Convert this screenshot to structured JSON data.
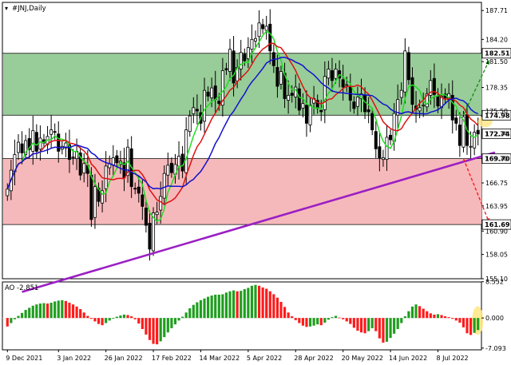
{
  "chart_data": [
    {
      "type": "candlestick",
      "title": "#JNJ,Daily",
      "ylim": [
        155.1,
        188.7
      ],
      "y_ticks": [
        187.71,
        184.2,
        181.5,
        178.35,
        175.5,
        172.74,
        169.7,
        166.75,
        163.95,
        160.9,
        158.05,
        155.1
      ],
      "price_labels": [
        {
          "value": 182.51,
          "color": "#ffffff"
        },
        {
          "value": 174.98,
          "color": "#ffffff"
        },
        {
          "value": 172.74,
          "color": "#ffffff"
        },
        {
          "value": 169.7,
          "color": "#ffffff"
        },
        {
          "value": 161.69,
          "color": "#ffffff"
        }
      ],
      "zones": [
        {
          "name": "resistance",
          "from": 174.98,
          "to": 182.51,
          "color": "#98cc98"
        },
        {
          "name": "support",
          "from": 161.69,
          "to": 169.7,
          "color": "#f6b9bb"
        }
      ],
      "x_labels": [
        "9 Dec 2021",
        "3 Jan 2022",
        "26 Jan 2022",
        "17 Feb 2022",
        "14 Mar 2022",
        "5 Apr 2022",
        "28 Apr 2022",
        "20 May 2022",
        "14 Jun 2022",
        "8 Jul 2022"
      ],
      "closes": [
        166.0,
        168.3,
        170.2,
        171.7,
        170.4,
        171.9,
        170.8,
        173.1,
        170.6,
        172.2,
        171.6,
        172.4,
        173.2,
        172.9,
        170.6,
        171.2,
        171.6,
        169.6,
        169.9,
        170.6,
        167.7,
        169.1,
        167.9,
        162.3,
        166.3,
        164.5,
        165.8,
        168.8,
        169.1,
        169.8,
        169.2,
        169.4,
        167.4,
        171.1,
        166.3,
        166.0,
        165.5,
        163.9,
        161.6,
        158.7,
        163.1,
        163.2,
        165.1,
        167.9,
        168.9,
        168.0,
        169.0,
        170.0,
        168.2,
        173.2,
        174.9,
        175.9,
        175.5,
        174.0,
        178.0,
        177.3,
        178.3,
        176.9,
        176.4,
        180.4,
        180.5,
        183.0,
        178.9,
        180.8,
        182.6,
        181.6,
        183.2,
        184.2,
        184.3,
        186.2,
        185.5,
        185.8,
        182.8,
        181.0,
        178.5,
        180.3,
        177.0,
        177.4,
        177.4,
        178.4,
        175.6,
        176.4,
        174.0,
        176.2,
        177.0,
        175.8,
        175.4,
        179.7,
        180.6,
        179.2,
        180.6,
        179.5,
        178.4,
        178.7,
        176.8,
        175.8,
        177.2,
        177.6,
        175.4,
        175.4,
        173.2,
        170.9,
        169.8,
        169.8,
        172.3,
        172.0,
        175.2,
        176.9,
        178.0,
        182.8,
        179.3,
        176.3,
        175.7,
        175.9,
        176.2,
        177.6,
        179.2,
        177.5,
        176.1,
        177.3,
        177.1,
        177.6,
        174.4,
        174.0,
        171.3,
        174.8,
        171.3,
        171.2,
        172.9,
        172.7
      ],
      "indicators": [
        {
          "name": "fast MA",
          "color": "#22dd22"
        },
        {
          "name": "mid MA",
          "color": "#dd1111"
        },
        {
          "name": "slow MA",
          "color": "#1111cc"
        }
      ],
      "trendline": {
        "color": "#9b1fc4",
        "from": [
          4,
          153.5
        ],
        "to": [
          131,
          170.3
        ]
      },
      "forecast_arrows": [
        {
          "color": "#1e8c1e",
          "from": [
            125,
            175.0
          ],
          "to": [
            131,
            181.7
          ]
        },
        {
          "color": "#ff1a1a",
          "from": [
            125,
            169.7
          ],
          "to": [
            131,
            161.9
          ]
        }
      ]
    },
    {
      "type": "bar",
      "title": "AO -2.851",
      "ylim": [
        -7.5,
        8.5
      ],
      "y_ticks": [
        8.552,
        0.0,
        -7.093
      ],
      "ao_values": [
        -2.0,
        -1.2,
        -0.3,
        0.5,
        1.2,
        1.9,
        2.4,
        2.9,
        3.2,
        3.4,
        3.5,
        3.4,
        3.6,
        3.9,
        4.1,
        4.2,
        4.0,
        3.6,
        3.2,
        2.7,
        2.1,
        1.3,
        0.5,
        -0.2,
        -0.8,
        -1.4,
        -1.7,
        -1.2,
        -0.6,
        -0.1,
        0.3,
        0.6,
        0.8,
        0.7,
        0.4,
        -0.3,
        -1.3,
        -2.6,
        -3.9,
        -5.2,
        -6.1,
        -6.2,
        -5.5,
        -4.5,
        -3.4,
        -2.4,
        -1.5,
        -0.6,
        0.3,
        1.3,
        2.3,
        3.1,
        3.7,
        4.2,
        4.6,
        5.0,
        5.3,
        5.5,
        5.5,
        5.6,
        6.0,
        6.3,
        6.5,
        6.3,
        6.4,
        6.8,
        7.1,
        7.6,
        7.8,
        7.6,
        7.2,
        6.9,
        6.3,
        5.6,
        4.8,
        3.8,
        2.6,
        1.3,
        0.4,
        -0.5,
        -1.2,
        -1.8,
        -2.1,
        -2.0,
        -1.8,
        -1.5,
        -1.7,
        -1.1,
        -0.4,
        0.2,
        0.5,
        0.1,
        -0.3,
        -0.8,
        -1.4,
        -2.3,
        -3.0,
        -3.4,
        -3.6,
        -3.1,
        -2.4,
        -3.1,
        -4.8,
        -5.8,
        -5.6,
        -4.7,
        -3.7,
        -2.6,
        -1.2,
        0.4,
        1.6,
        2.7,
        3.2,
        2.8,
        2.2,
        1.6,
        1.1,
        0.8,
        0.9,
        0.7,
        0.4,
        0.2,
        -0.2,
        -0.6,
        -1.1,
        -2.2,
        -3.6,
        -4.0,
        -3.5,
        -2.85
      ],
      "colors": {
        "up": "#1f9e1f",
        "down": "#ff1a1a"
      },
      "highlight_color": "#ffe88a"
    }
  ]
}
